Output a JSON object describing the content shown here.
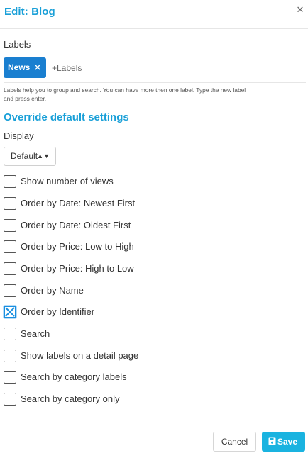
{
  "dialog": {
    "title": "Edit: Blog",
    "close_icon": "close-icon"
  },
  "labels": {
    "title": "Labels",
    "tags": [
      {
        "text": "News"
      }
    ],
    "input_placeholder": "+Labels",
    "help_line1": "Labels help you to group and search. You can have more then one label. Type the new label",
    "help_line2": "and press enter."
  },
  "override": {
    "title": "Override default settings",
    "display_label": "Display",
    "display_value": "Default"
  },
  "options": [
    {
      "label": "Show number of views",
      "checked": false
    },
    {
      "label": "Order by Date: Newest First",
      "checked": false
    },
    {
      "label": "Order by Date: Oldest First",
      "checked": false
    },
    {
      "label": "Order by Price: Low to High",
      "checked": false
    },
    {
      "label": "Order by Price: High to Low",
      "checked": false
    },
    {
      "label": "Order by Name",
      "checked": false
    },
    {
      "label": "Order by Identifier",
      "checked": true
    },
    {
      "label": "Search",
      "checked": false
    },
    {
      "label": "Show labels on a detail page",
      "checked": false
    },
    {
      "label": "Search by category labels",
      "checked": false
    },
    {
      "label": "Search by category only",
      "checked": false
    }
  ],
  "footer": {
    "cancel_label": "Cancel",
    "save_label": "Save",
    "save_icon": "floppy-disk-icon"
  },
  "colors": {
    "accent": "#1aa0d8",
    "tag_bg": "#1a7fd0",
    "save_bg": "#1ab3e0",
    "checked_border": "#1a8fe0"
  }
}
